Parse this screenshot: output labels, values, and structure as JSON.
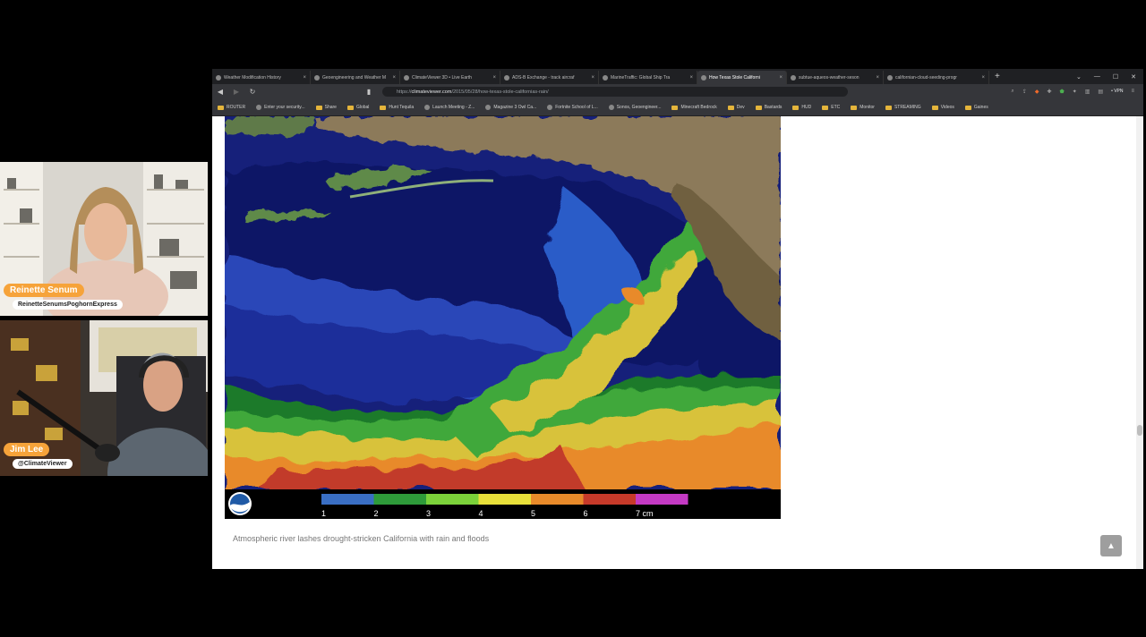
{
  "browser": {
    "tabs": [
      {
        "label": "Weather Modification History",
        "active": false
      },
      {
        "label": "Geoengineering and Weather M",
        "active": false
      },
      {
        "label": "ClimateViewer 3D • Live Earth",
        "active": false
      },
      {
        "label": "ADS-B Exchange - track aircraf",
        "active": false
      },
      {
        "label": "MarineTraffic: Global Ship Tra",
        "active": false
      },
      {
        "label": "How Texas Stole Californi",
        "active": true
      },
      {
        "label": "subtue-aqueos-weather-seson",
        "active": false
      },
      {
        "label": "californian-cloud-seeding-progr",
        "active": false
      }
    ],
    "new_tab": "+",
    "url_prefix": "https://",
    "url_domain": "climateviewer.com",
    "url_path": "/2015/05/28/how-texas-stole-californias-rain/",
    "vpn_label": "• VPN",
    "bookmarks": [
      {
        "label": "ROUTER",
        "type": "folder"
      },
      {
        "label": "Enter your security...",
        "type": "site"
      },
      {
        "label": "Share",
        "type": "folder"
      },
      {
        "label": "Global",
        "type": "folder"
      },
      {
        "label": "Hunt Tequila",
        "type": "folder"
      },
      {
        "label": "Launch Meeting - Z...",
        "type": "site"
      },
      {
        "label": "Magazine 3 Owl Ca...",
        "type": "site"
      },
      {
        "label": "Fortnite School of L...",
        "type": "site"
      },
      {
        "label": "Sonos, Geoengineer...",
        "type": "site"
      },
      {
        "label": "Minecraft Bedrock",
        "type": "folder"
      },
      {
        "label": "Dev",
        "type": "folder"
      },
      {
        "label": "Bastards",
        "type": "folder"
      },
      {
        "label": "HUD",
        "type": "folder"
      },
      {
        "label": "ETC",
        "type": "folder"
      },
      {
        "label": "Monitor",
        "type": "folder"
      },
      {
        "label": "STREAMING",
        "type": "folder"
      },
      {
        "label": "Videos",
        "type": "folder"
      },
      {
        "label": "Gaines",
        "type": "folder"
      }
    ]
  },
  "figure": {
    "legend_ticks": [
      "1",
      "2",
      "3",
      "4",
      "5",
      "6",
      "7 cm"
    ],
    "legend_colors": [
      "#3a6fc4",
      "#2e9b3a",
      "#7bd23a",
      "#e8e03a",
      "#e88a2a",
      "#c73a2a",
      "#c43ac4"
    ],
    "caption": "Atmospheric river lashes drought-stricken California with rain and floods",
    "logo": "NOAA"
  },
  "participants": [
    {
      "name": "Reinette Senum",
      "handle": "ReinetteSenumsPoghornExpress"
    },
    {
      "name": "Jim Lee",
      "handle": "@ClimateViewer"
    }
  ]
}
